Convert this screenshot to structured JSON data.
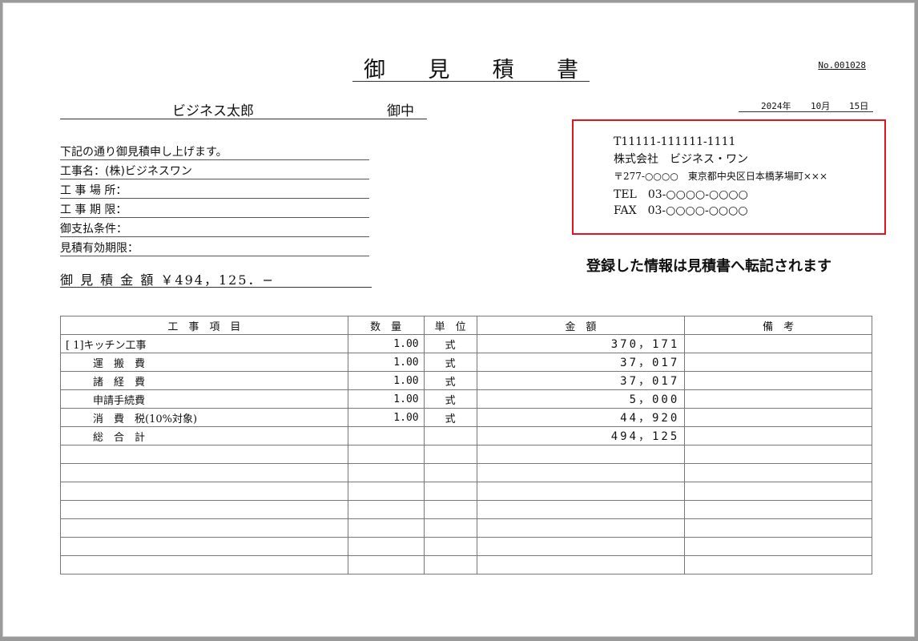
{
  "document": {
    "title_chars": [
      "御",
      "見",
      "積",
      "書"
    ],
    "doc_no": "No.001028",
    "date": {
      "year": "2024年",
      "month": "10月",
      "day": "15日"
    },
    "addressee": {
      "name": "ビジネス太郎",
      "honorific": "御中"
    },
    "intro": "下記の通り御見積申し上げます。",
    "fields": [
      "工事名：(株)ビジネスワン",
      "工 事 場 所：",
      "工 事 期 限：",
      "御支払条件：",
      "見積有効期限："
    ],
    "total_line": "御 見 積 金 額 ￥494，125．−"
  },
  "company": {
    "reg_no": "T11111-111111-1111",
    "name": "株式会社　ビジネス・ワン",
    "address": "〒277-○○○○　東京都中央区日本橋茅場町×××",
    "tel": "TEL　03-○○○○-○○○○",
    "fax": "FAX　03-○○○○-○○○○"
  },
  "notice": "登録した情報は見積書へ転記されます",
  "table": {
    "headers": [
      "工　事　項　目",
      "数　量",
      "単　位",
      "金　額",
      "備　考"
    ],
    "rows": [
      {
        "item": "[ 1]キッチン工事",
        "qty": "1.00",
        "unit": "式",
        "amount": "370，171",
        "note": ""
      },
      {
        "item": "運　搬　費",
        "qty": "1.00",
        "unit": "式",
        "amount": "37，017",
        "note": ""
      },
      {
        "item": "諸　経　費",
        "qty": "1.00",
        "unit": "式",
        "amount": "37，017",
        "note": ""
      },
      {
        "item": "申請手続費",
        "qty": "1.00",
        "unit": "式",
        "amount": "5，000",
        "note": ""
      },
      {
        "item": "消　費　税(10%対象)",
        "qty": "1.00",
        "unit": "式",
        "amount": "44，920",
        "note": ""
      },
      {
        "item": "総　合　計",
        "qty": "",
        "unit": "",
        "amount": "494，125",
        "note": ""
      },
      {
        "item": "",
        "qty": "",
        "unit": "",
        "amount": "",
        "note": ""
      },
      {
        "item": "",
        "qty": "",
        "unit": "",
        "amount": "",
        "note": ""
      },
      {
        "item": "",
        "qty": "",
        "unit": "",
        "amount": "",
        "note": ""
      },
      {
        "item": "",
        "qty": "",
        "unit": "",
        "amount": "",
        "note": ""
      },
      {
        "item": "",
        "qty": "",
        "unit": "",
        "amount": "",
        "note": ""
      },
      {
        "item": "",
        "qty": "",
        "unit": "",
        "amount": "",
        "note": ""
      },
      {
        "item": "",
        "qty": "",
        "unit": "",
        "amount": "",
        "note": ""
      }
    ]
  },
  "colors": {
    "highlight_border": "#e0141c",
    "ink": "#111111"
  }
}
